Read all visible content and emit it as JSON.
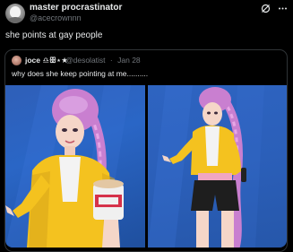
{
  "post": {
    "display_name": "master procrastinator",
    "handle": "@acecrownnn",
    "text": "she points at gay people"
  },
  "quote": {
    "display_name": "joce ♎︎ꕥ⋆★",
    "handle": "@desolatist",
    "separator": "·",
    "date": "Jan 28",
    "text": "why does she keep pointing at me..........",
    "images": [
      {
        "alt_subject": "pink-haired figure in yellow jacket pointing, holding ice cream"
      },
      {
        "alt_subject": "pink-haired figure in yellow jacket pointing, full body"
      }
    ]
  },
  "header_icons": [
    "grok-icon",
    "more-icon"
  ],
  "colors": {
    "background": "#000000",
    "text_primary": "#e7e9ea",
    "text_secondary": "#71767b",
    "border": "#2f3336",
    "jacket_yellow": "#f4c21f",
    "hair_pink": "#c97fd0",
    "image_bg_blue": "#2a66c6"
  }
}
